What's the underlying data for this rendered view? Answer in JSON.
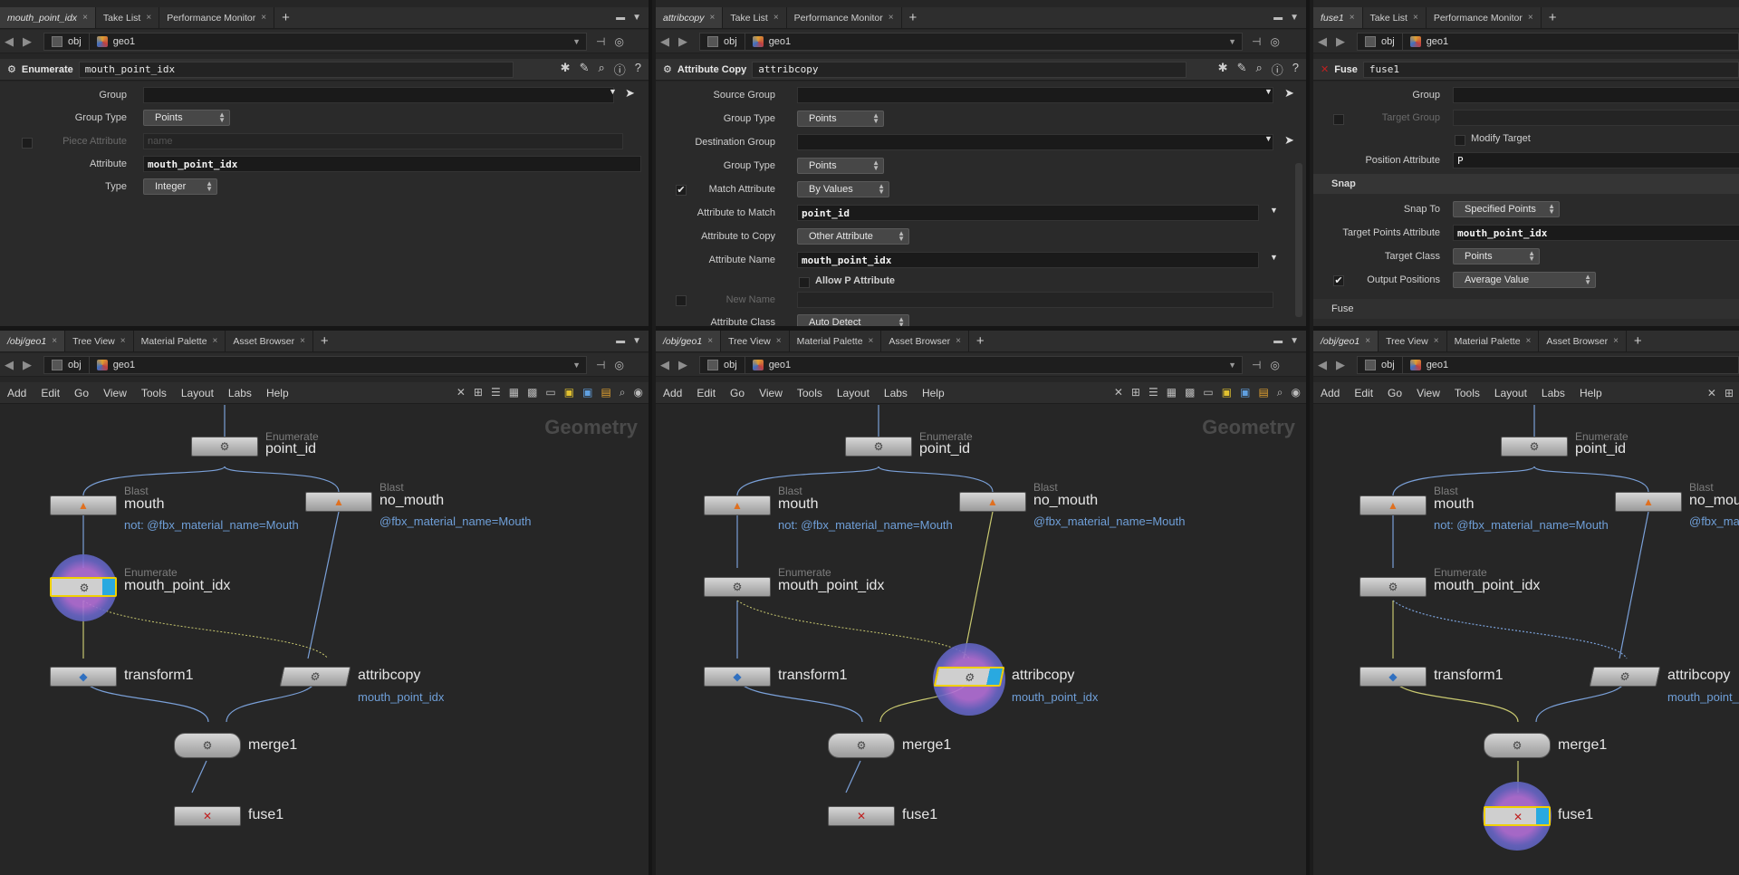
{
  "panes": [
    {
      "top_tabs": [
        {
          "label": "mouth_point_idx",
          "active": true
        },
        {
          "label": "Take List",
          "active": false
        },
        {
          "label": "Performance Monitor",
          "active": false
        }
      ],
      "path": {
        "obj": "obj",
        "geo": "geo1"
      },
      "op_type": "Enumerate",
      "op_name": "mouth_point_idx",
      "params": {
        "group_label": "Group",
        "group_type_label": "Group Type",
        "group_type_value": "Points",
        "piece_attr_label": "Piece Attribute",
        "piece_attr_placeholder": "name",
        "attribute_label": "Attribute",
        "attribute_value": "mouth_point_idx",
        "type_label": "Type",
        "type_value": "Integer"
      },
      "bottom_tabs": [
        {
          "label": "/obj/geo1",
          "active": true
        },
        {
          "label": "Tree View",
          "active": false
        },
        {
          "label": "Material Palette",
          "active": false
        },
        {
          "label": "Asset Browser",
          "active": false
        }
      ]
    },
    {
      "top_tabs": [
        {
          "label": "attribcopy",
          "active": true
        },
        {
          "label": "Take List",
          "active": false
        },
        {
          "label": "Performance Monitor",
          "active": false
        }
      ],
      "path": {
        "obj": "obj",
        "geo": "geo1"
      },
      "op_type": "Attribute Copy",
      "op_name": "attribcopy",
      "params": {
        "source_group_label": "Source Group",
        "group_type_label": "Group Type",
        "group_type_value": "Points",
        "dest_group_label": "Destination Group",
        "group_type2_label": "Group Type",
        "group_type2_value": "Points",
        "match_attr_label": "Match Attribute",
        "match_attr_value": "By Values",
        "attr_to_match_label": "Attribute to Match",
        "attr_to_match_value": "point_id",
        "attr_to_copy_label": "Attribute to Copy",
        "attr_to_copy_value": "Other Attribute",
        "attr_name_label": "Attribute Name",
        "attr_name_value": "mouth_point_idx",
        "allow_p_label": "Allow P Attribute",
        "new_name_label": "New Name",
        "attr_class_label": "Attribute Class",
        "attr_class_value": "Auto Detect"
      },
      "bottom_tabs": [
        {
          "label": "/obj/geo1",
          "active": true
        },
        {
          "label": "Tree View",
          "active": false
        },
        {
          "label": "Material Palette",
          "active": false
        },
        {
          "label": "Asset Browser",
          "active": false
        }
      ]
    },
    {
      "top_tabs": [
        {
          "label": "fuse1",
          "active": true
        },
        {
          "label": "Take List",
          "active": false
        },
        {
          "label": "Performance Monitor",
          "active": false
        }
      ],
      "path": {
        "obj": "obj",
        "geo": "geo1"
      },
      "op_type": "Fuse",
      "op_name": "fuse1",
      "params": {
        "group_label": "Group",
        "target_group_label": "Target Group",
        "modify_target_label": "Modify Target",
        "position_attr_label": "Position Attribute",
        "position_attr_value": "P",
        "snap_section": "Snap",
        "snap_to_label": "Snap To",
        "snap_to_value": "Specified Points",
        "target_points_attr_label": "Target Points Attribute",
        "target_points_attr_value": "mouth_point_idx",
        "target_class_label": "Target Class",
        "target_class_value": "Points",
        "output_positions_label": "Output Positions",
        "output_positions_value": "Average Value",
        "fuse_section": "Fuse"
      },
      "bottom_tabs": [
        {
          "label": "/obj/geo1",
          "active": true
        },
        {
          "label": "Tree View",
          "active": false
        },
        {
          "label": "Material Palette",
          "active": false
        },
        {
          "label": "Asset Browser",
          "active": false
        }
      ]
    }
  ],
  "menu": [
    "Add",
    "Edit",
    "Go",
    "View",
    "Tools",
    "Layout",
    "Labs",
    "Help"
  ],
  "network_label": "Geometry",
  "nodes": {
    "point_id": {
      "type": "Enumerate",
      "name": "point_id"
    },
    "mouth": {
      "type": "Blast",
      "name": "mouth",
      "info": "not: @fbx_material_name=Mouth"
    },
    "no_mouth": {
      "type": "Blast",
      "name": "no_mouth",
      "info": "@fbx_material_name=Mouth"
    },
    "mouth_point_idx": {
      "type": "Enumerate",
      "name": "mouth_point_idx"
    },
    "transform1": {
      "name": "transform1"
    },
    "attribcopy": {
      "name": "attribcopy",
      "info": "mouth_point_idx"
    },
    "merge1": {
      "name": "merge1"
    },
    "fuse1": {
      "name": "fuse1"
    }
  },
  "colors": {
    "accent_yellow": "#f0d000",
    "display_blue": "#29a9e0",
    "info_blue": "#6f9fd8",
    "wire": "#7aa0d8"
  }
}
